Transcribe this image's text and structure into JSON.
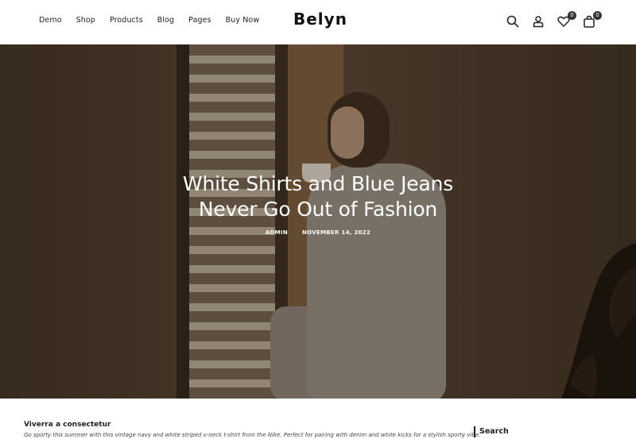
{
  "header": {
    "nav": [
      "Demo",
      "Shop",
      "Products",
      "Blog",
      "Pages",
      "Buy Now"
    ],
    "logo": "Belyn",
    "wishlist_count": "0",
    "cart_count": "0"
  },
  "hero": {
    "title_line1": "White Shirts and Blue Jeans",
    "title_line2": "Never Go Out of Fashion",
    "author": "ADMIN",
    "date": "NOVEMBER 14, 2022"
  },
  "content": {
    "post_title": "Viverra a consectetur",
    "post_excerpt": "Go sporty this summer with this vintage navy and white striped v-neck t-shirt from the Nike. Perfect for pairing with denim and white kicks for a stylish sporty vibe.",
    "sidebar_widget_title": "Search"
  },
  "colors": {
    "text": "#222222",
    "hero_text": "#ffffff",
    "badge": "#333333"
  },
  "icons": [
    "search-icon",
    "user-icon",
    "heart-icon",
    "cart-icon"
  ]
}
